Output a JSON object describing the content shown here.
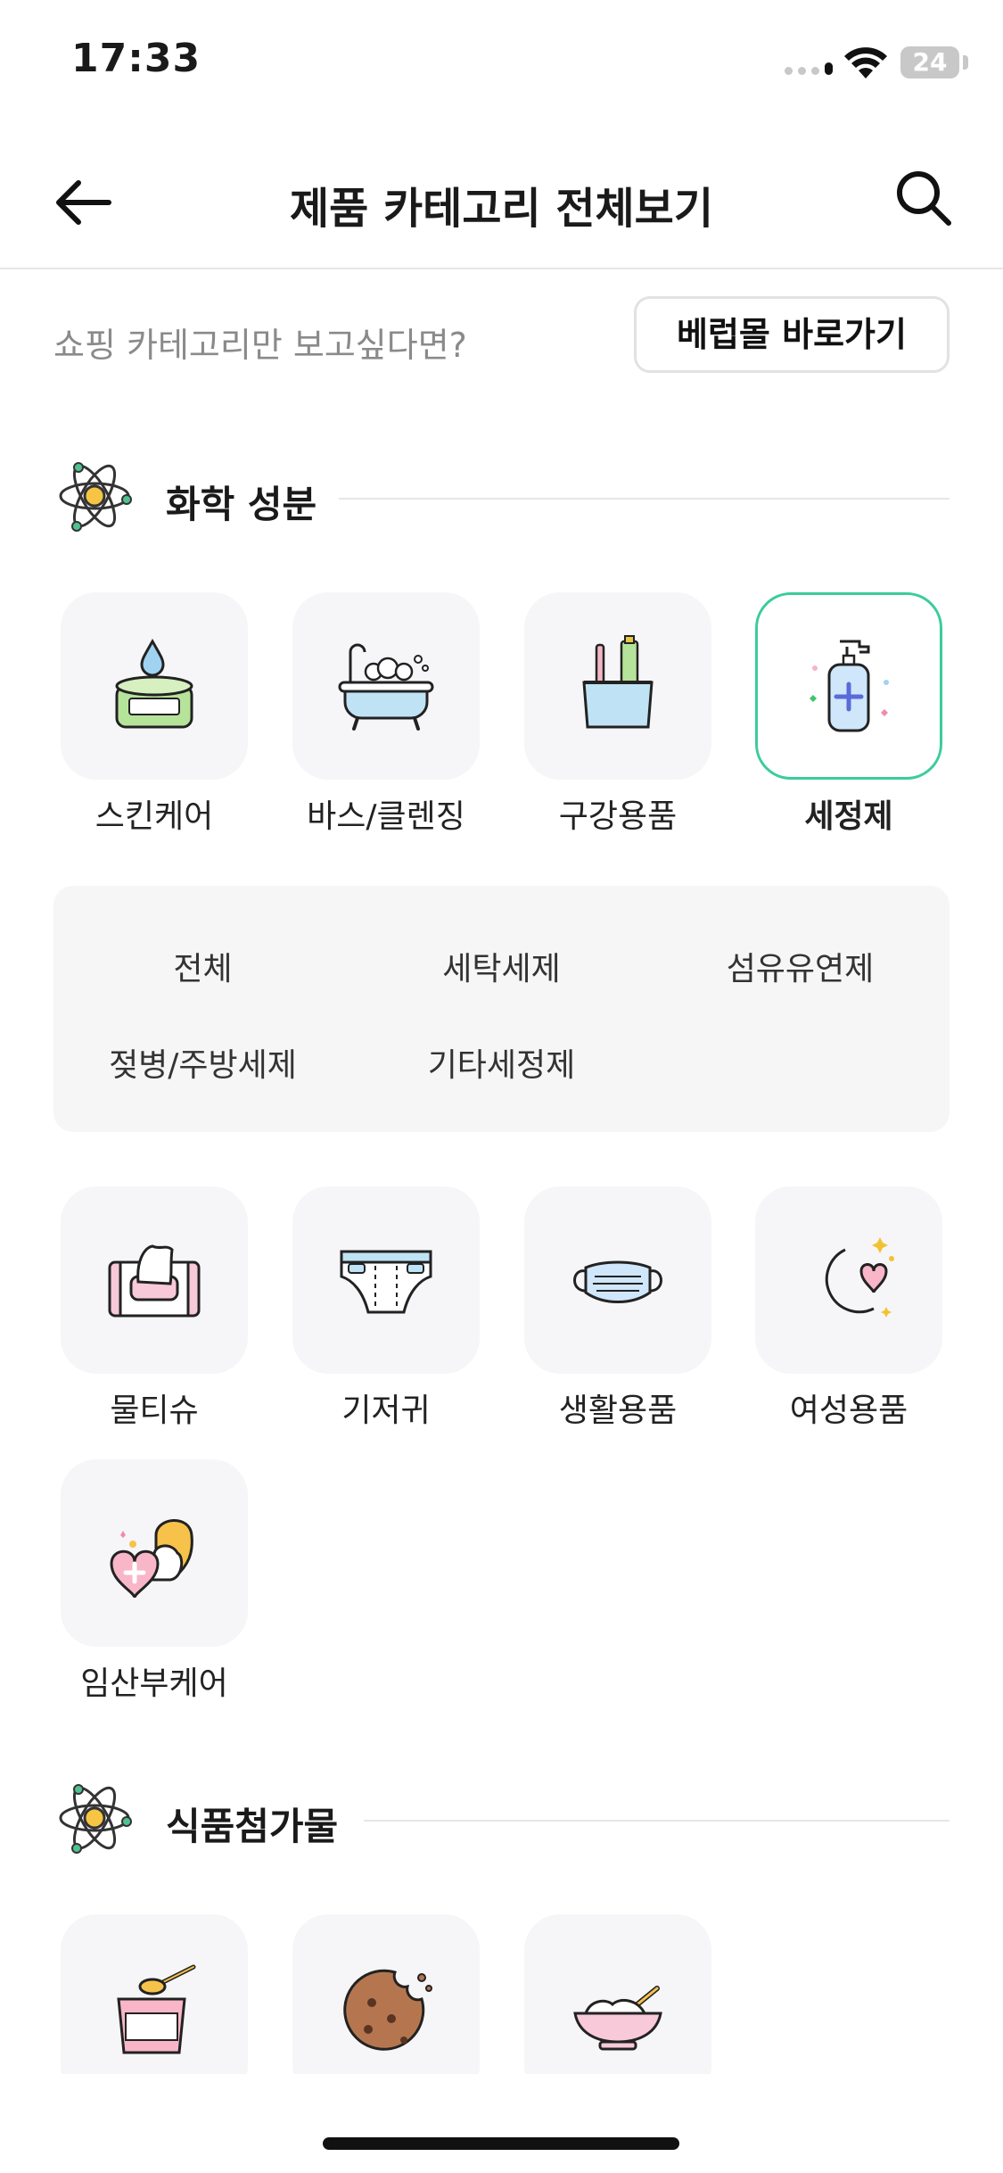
{
  "status": {
    "time": "17:33",
    "battery": "24"
  },
  "nav": {
    "title": "제품 카테고리 전체보기",
    "back_icon": "arrow-left-icon",
    "search_icon": "search-icon"
  },
  "promo": {
    "text": "쇼핑 카테고리만 보고싶다면?",
    "button": "베럽몰 바로가기"
  },
  "sections": [
    {
      "title": "화학 성분",
      "icon": "atom-icon",
      "categories": [
        {
          "label": "스킨케어",
          "icon": "cream-jar-icon",
          "selected": false
        },
        {
          "label": "바스/클렌징",
          "icon": "bathtub-icon",
          "selected": false
        },
        {
          "label": "구강용품",
          "icon": "toothbrush-cup-icon",
          "selected": false
        },
        {
          "label": "세정제",
          "icon": "sanitizer-bottle-icon",
          "selected": true
        },
        {
          "label": "물티슈",
          "icon": "wet-wipes-icon",
          "selected": false
        },
        {
          "label": "기저귀",
          "icon": "diaper-icon",
          "selected": false
        },
        {
          "label": "생활용품",
          "icon": "face-mask-icon",
          "selected": false
        },
        {
          "label": "여성용품",
          "icon": "moon-heart-icon",
          "selected": false
        },
        {
          "label": "임산부케어",
          "icon": "heart-care-icon",
          "selected": false
        }
      ],
      "subcategories": [
        "전체",
        "세탁세제",
        "섬유유연제",
        "젖병/주방세제",
        "기타세정제"
      ]
    },
    {
      "title": "식품첨가물",
      "icon": "atom-icon",
      "categories": [
        {
          "label": "",
          "icon": "formula-cup-icon"
        },
        {
          "label": "",
          "icon": "cookie-icon"
        },
        {
          "label": "",
          "icon": "baby-food-bowl-icon"
        }
      ]
    }
  ],
  "colors": {
    "accent": "#3ccc9a",
    "tile_bg": "#f6f6f8",
    "muted_text": "#8a8a8a"
  }
}
